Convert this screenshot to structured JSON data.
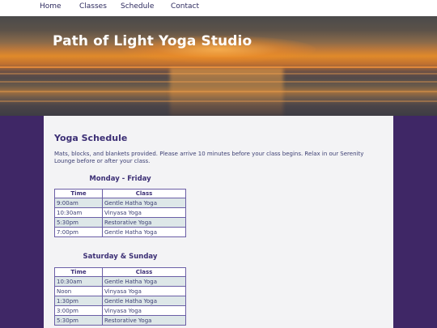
{
  "nav": {
    "items": [
      {
        "label": "Home"
      },
      {
        "label": "Classes"
      },
      {
        "label": "Schedule"
      },
      {
        "label": "Contact"
      }
    ]
  },
  "hero": {
    "title": "Path of Light Yoga Studio"
  },
  "main": {
    "heading": "Yoga Schedule",
    "intro": "Mats, blocks, and blankets provided. Please arrive 10 minutes before your class begins. Relax in our Serenity Lounge before or after your class.",
    "weekday": {
      "title": "Monday - Friday",
      "headers": [
        "Time",
        "Class"
      ],
      "rows": [
        {
          "time": "9:00am",
          "class": "Gentle Hatha Yoga"
        },
        {
          "time": "10:30am",
          "class": "Vinyasa Yoga"
        },
        {
          "time": "5:30pm",
          "class": "Restorative Yoga"
        },
        {
          "time": "7:00pm",
          "class": "Gentle Hatha Yoga"
        }
      ]
    },
    "weekend": {
      "title": "Saturday & Sunday",
      "headers": [
        "Time",
        "Class"
      ],
      "rows": [
        {
          "time": "10:30am",
          "class": "Gentle Hatha Yoga"
        },
        {
          "time": "Noon",
          "class": "Vinyasa Yoga"
        },
        {
          "time": "1:30pm",
          "class": "Gentle Hatha Yoga"
        },
        {
          "time": "3:00pm",
          "class": "Vinyasa Yoga"
        },
        {
          "time": "5:30pm",
          "class": "Restorative Yoga"
        }
      ]
    }
  },
  "colors": {
    "page_background": "#3f2766",
    "content_background": "#f3f3f5",
    "heading": "#3c2f75",
    "text": "#3c3f73",
    "table_border": "#6b5fa6",
    "row_shade": "#dde7e8"
  }
}
